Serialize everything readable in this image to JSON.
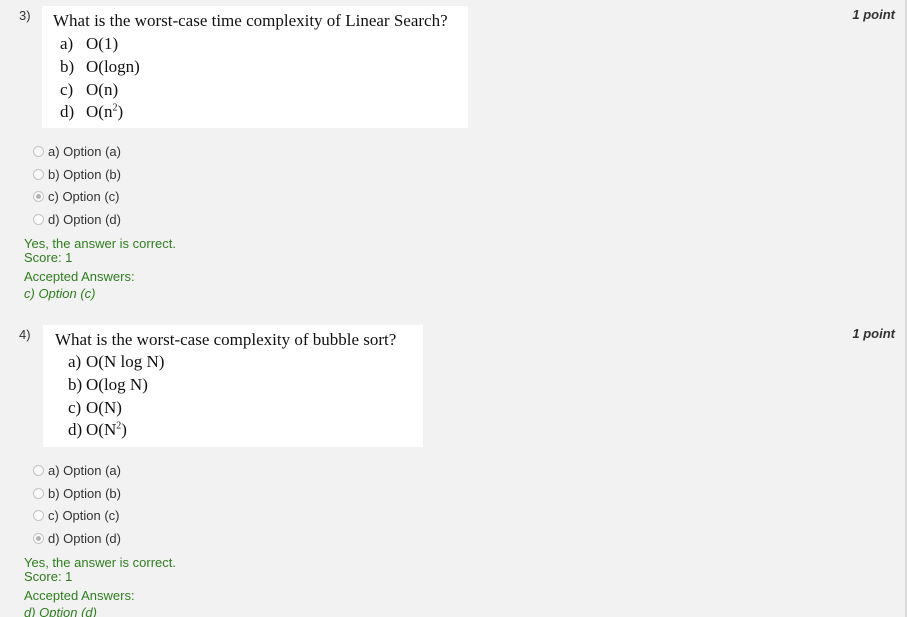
{
  "questions": [
    {
      "number": "3)",
      "points": "1 point",
      "prompt": "What is the worst-case time complexity of Linear Search?",
      "image_options": [
        {
          "letter": "a)",
          "text": "O(1)"
        },
        {
          "letter": "b)",
          "text": "O(logn)"
        },
        {
          "letter": "c)",
          "text": "O(n)"
        },
        {
          "letter": "d)",
          "text": "O(n",
          "sup": "2",
          "tail": ")"
        }
      ],
      "choices": [
        {
          "label": "a) Option (a)",
          "checked": false
        },
        {
          "label": "b) Option (b)",
          "checked": false
        },
        {
          "label": "c) Option (c)",
          "checked": true
        },
        {
          "label": "d) Option (d)",
          "checked": false
        }
      ],
      "feedback": "Yes, the answer is correct.",
      "score": "Score: 1",
      "accepted_label": "Accepted Answers:",
      "accepted_answer": "c) Option (c)"
    },
    {
      "number": "4)",
      "points": "1 point",
      "prompt": "What is the worst-case complexity of bubble sort?",
      "image_options": [
        {
          "letter": "a)",
          "text": "O(N log N)"
        },
        {
          "letter": "b)",
          "text": "O(log N)"
        },
        {
          "letter": "c)",
          "text": "O(N)"
        },
        {
          "letter": "d)",
          "text": "O(N",
          "sup": "2",
          "tail": ")"
        }
      ],
      "choices": [
        {
          "label": "a) Option (a)",
          "checked": false
        },
        {
          "label": "b) Option (b)",
          "checked": false
        },
        {
          "label": "c) Option (c)",
          "checked": false
        },
        {
          "label": "d) Option (d)",
          "checked": true
        }
      ],
      "feedback": "Yes, the answer is correct.",
      "score": "Score: 1",
      "accepted_label": "Accepted Answers:",
      "accepted_answer": "d) Option (d)"
    }
  ],
  "colors": {
    "background": "#f2f2f2",
    "feedback_green": "#2e7d1e",
    "question_box": "#ffffff"
  }
}
